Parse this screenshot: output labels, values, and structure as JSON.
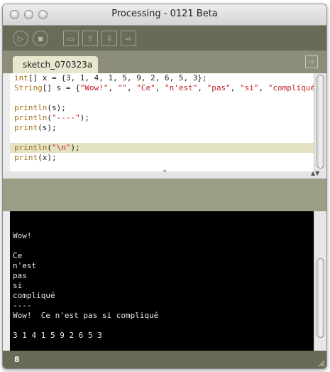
{
  "window": {
    "title": "Processing - 0121 Beta"
  },
  "toolbar": {
    "buttons": [
      {
        "icon": "run-icon",
        "glyph": "▷"
      },
      {
        "icon": "stop-icon",
        "glyph": "■"
      },
      {
        "icon": "new-icon",
        "glyph": "▭"
      },
      {
        "icon": "open-icon",
        "glyph": "⇧"
      },
      {
        "icon": "save-icon",
        "glyph": "⇩"
      },
      {
        "icon": "export-icon",
        "glyph": "⇨"
      }
    ]
  },
  "tabs": {
    "active_label": "sketch_070323a",
    "menu_glyph": "⇨"
  },
  "editor": {
    "lines": [
      {
        "parts": [
          {
            "t": "int",
            "c": "kw"
          },
          {
            "t": "[] x = {3, 1, 4, 1, 5, 9, 2, 6, 5, 3};",
            "c": ""
          }
        ]
      },
      {
        "parts": [
          {
            "t": "String",
            "c": "kw"
          },
          {
            "t": "[] s = {",
            "c": ""
          },
          {
            "t": "\"Wow!\"",
            "c": "str"
          },
          {
            "t": ", ",
            "c": ""
          },
          {
            "t": "\"\"",
            "c": "str"
          },
          {
            "t": ", ",
            "c": ""
          },
          {
            "t": "\"Ce\"",
            "c": "str"
          },
          {
            "t": ", ",
            "c": ""
          },
          {
            "t": "\"n'est\"",
            "c": "str"
          },
          {
            "t": ", ",
            "c": ""
          },
          {
            "t": "\"pas\"",
            "c": "str"
          },
          {
            "t": ", ",
            "c": ""
          },
          {
            "t": "\"si\"",
            "c": "str"
          },
          {
            "t": ", ",
            "c": ""
          },
          {
            "t": "\"compliqué\"",
            "c": "str"
          },
          {
            "t": "};",
            "c": ""
          }
        ]
      },
      {
        "parts": []
      },
      {
        "parts": [
          {
            "t": "println",
            "c": "fn"
          },
          {
            "t": "(s);",
            "c": ""
          }
        ]
      },
      {
        "parts": [
          {
            "t": "println",
            "c": "fn"
          },
          {
            "t": "(",
            "c": ""
          },
          {
            "t": "\"----\"",
            "c": "str"
          },
          {
            "t": ");",
            "c": ""
          }
        ]
      },
      {
        "parts": [
          {
            "t": "print",
            "c": "fn"
          },
          {
            "t": "(s);",
            "c": ""
          }
        ]
      },
      {
        "parts": []
      },
      {
        "parts": [
          {
            "t": "println",
            "c": "fn"
          },
          {
            "t": "(",
            "c": ""
          },
          {
            "t": "\"\\n\"",
            "c": "str"
          },
          {
            "t": ");",
            "c": ""
          }
        ],
        "highlight": true
      },
      {
        "parts": [
          {
            "t": "print",
            "c": "fn"
          },
          {
            "t": "(x);",
            "c": ""
          }
        ]
      }
    ]
  },
  "divider": {
    "collapse_glyph": "⌃"
  },
  "console": {
    "lines": [
      "",
      "",
      "Wow!",
      "",
      "Ce",
      "n'est",
      "pas",
      "si",
      "compliqué",
      "----",
      "Wow!  Ce n'est pas si compliqué",
      "",
      "3 1 4 1 5 9 2 6 5 3"
    ]
  },
  "status": {
    "line_number": "8"
  },
  "colors": {
    "toolbar": "#686b56",
    "tabbar": "#8d8e7a",
    "active_tab": "#e8e6cf",
    "keyword": "#a9711a",
    "string": "#c02020",
    "highlight_line": "#e3e2c2",
    "console_bg": "#000000"
  }
}
